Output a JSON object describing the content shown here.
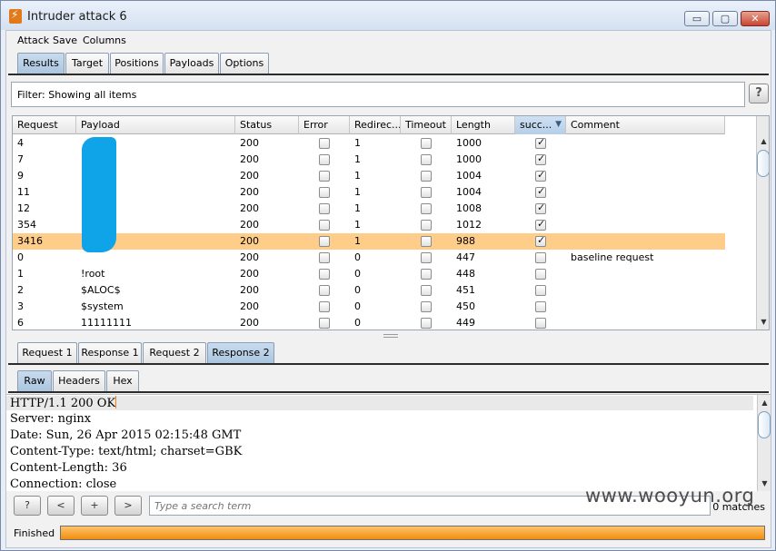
{
  "window": {
    "title": "Intruder attack 6",
    "minimize": "▭",
    "maximize": "▢",
    "close": "✕"
  },
  "menu": {
    "items": [
      "Attack",
      "Save",
      "Columns"
    ]
  },
  "main_tabs": [
    "Results",
    "Target",
    "Positions",
    "Payloads",
    "Options"
  ],
  "filter": {
    "text": "Filter:  Showing all items",
    "help": "?"
  },
  "table": {
    "columns": [
      "Request",
      "Payload",
      "Status",
      "Error",
      "Redirec...",
      "Timeout",
      "Length",
      "succ...",
      "Comment"
    ],
    "sort_icon": "▼",
    "rows": [
      {
        "request": "4",
        "payload": "",
        "status": "200",
        "error": false,
        "redirect": "1",
        "timeout": false,
        "length": "1000",
        "success": true,
        "comment": ""
      },
      {
        "request": "7",
        "payload": "",
        "status": "200",
        "error": false,
        "redirect": "1",
        "timeout": false,
        "length": "1000",
        "success": true,
        "comment": ""
      },
      {
        "request": "9",
        "payload": "",
        "status": "200",
        "error": false,
        "redirect": "1",
        "timeout": false,
        "length": "1004",
        "success": true,
        "comment": ""
      },
      {
        "request": "11",
        "payload": "",
        "status": "200",
        "error": false,
        "redirect": "1",
        "timeout": false,
        "length": "1004",
        "success": true,
        "comment": ""
      },
      {
        "request": "12",
        "payload": "",
        "status": "200",
        "error": false,
        "redirect": "1",
        "timeout": false,
        "length": "1008",
        "success": true,
        "comment": ""
      },
      {
        "request": "354",
        "payload": "",
        "status": "200",
        "error": false,
        "redirect": "1",
        "timeout": false,
        "length": "1012",
        "success": true,
        "comment": ""
      },
      {
        "request": "3416",
        "payload": "",
        "status": "200",
        "error": false,
        "redirect": "1",
        "timeout": false,
        "length": "988",
        "success": true,
        "comment": "",
        "selected": true
      },
      {
        "request": "0",
        "payload": "",
        "status": "200",
        "error": false,
        "redirect": "0",
        "timeout": false,
        "length": "447",
        "success": false,
        "comment": "baseline request"
      },
      {
        "request": "1",
        "payload": "!root",
        "status": "200",
        "error": false,
        "redirect": "0",
        "timeout": false,
        "length": "448",
        "success": false,
        "comment": ""
      },
      {
        "request": "2",
        "payload": "$ALOC$",
        "status": "200",
        "error": false,
        "redirect": "0",
        "timeout": false,
        "length": "451",
        "success": false,
        "comment": ""
      },
      {
        "request": "3",
        "payload": "$system",
        "status": "200",
        "error": false,
        "redirect": "0",
        "timeout": false,
        "length": "450",
        "success": false,
        "comment": ""
      },
      {
        "request": "6",
        "payload": "11111111",
        "status": "200",
        "error": false,
        "redirect": "0",
        "timeout": false,
        "length": "449",
        "success": false,
        "comment": ""
      }
    ]
  },
  "req_resp_tabs": [
    "Request 1",
    "Response 1",
    "Request 2",
    "Response 2"
  ],
  "view_tabs": [
    "Raw",
    "Headers",
    "Hex"
  ],
  "response_lines": [
    "HTTP/1.1 200 OK",
    "Server: nginx",
    "Date: Sun, 26 Apr 2015 02:15:48 GMT",
    "Content-Type: text/html; charset=GBK",
    "Content-Length: 36",
    "Connection: close"
  ],
  "search": {
    "help": "?",
    "prev": "<",
    "add": "+",
    "next": ">",
    "placeholder": "Type a search term",
    "matches": "0 matches"
  },
  "status": {
    "text": "Finished",
    "progress": 1.0
  },
  "watermark": "www.wooyun.org",
  "colors": {
    "selected_row": "#ffcd8a",
    "progress": "#f08d10",
    "active_tab": "#b5cde6",
    "redaction": "#0fa3e8"
  }
}
